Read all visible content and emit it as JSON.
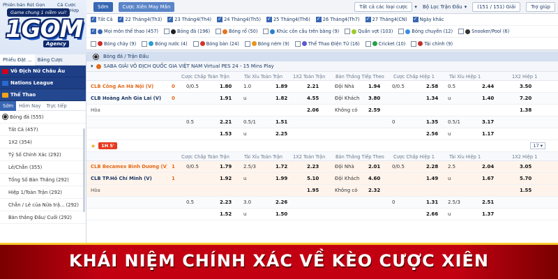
{
  "logo": {
    "top_left": "Phiên bản Rút Gọn",
    "top_right": "Cá Cược Tổng Hợp",
    "ribbon": "Game chung 1 niềm vui!",
    "brand": "1GOM",
    "agency": "Agency"
  },
  "topbar": {
    "tab_som": "Sớm",
    "tab_xien": "Cược Xiên May Mắn",
    "select_all_types": "Tất cả các loại cược",
    "filter_matches": "Bộ Lọc Trận Đấu",
    "pager": "(151 / 151)",
    "pager_suffix": "Giải",
    "help": "Trợ giúp"
  },
  "date_filters": [
    {
      "label": "Tất Cả",
      "checked": true
    },
    {
      "label": "22 Tháng4(Th3)",
      "checked": true
    },
    {
      "label": "23 Tháng4(Th4)",
      "checked": true
    },
    {
      "label": "24 Tháng4(Th5)",
      "checked": true
    },
    {
      "label": "25 Tháng4(Th6)",
      "checked": true
    },
    {
      "label": "26 Tháng4(Th7)",
      "checked": true
    },
    {
      "label": "27 Tháng4(CN)",
      "checked": true
    },
    {
      "label": "Ngày khác",
      "checked": true
    }
  ],
  "sport_filters_row1": [
    {
      "label": "Mọi môn thể thao (457)",
      "checked": true,
      "color": "#3867b3"
    },
    {
      "label": "Bóng đá (196)",
      "checked": false,
      "color": "#222222"
    },
    {
      "label": "Bóng rổ (50)",
      "checked": false,
      "color": "#e8741c"
    },
    {
      "label": "Khúc côn cầu trên băng (9)",
      "checked": false,
      "color": "#2a7fd0"
    },
    {
      "label": "Quần vợt (103)",
      "checked": false,
      "color": "#9ccc2a"
    },
    {
      "label": "Bóng chuyền (12)",
      "checked": false,
      "color": "#3c8fe0"
    },
    {
      "label": "Snooker/Pool (6)",
      "checked": false,
      "color": "#333333"
    }
  ],
  "sport_filters_row2": [
    {
      "label": "Bóng chày (9)",
      "checked": false,
      "color": "#cc2a2a"
    },
    {
      "label": "Bóng nước (4)",
      "checked": false,
      "color": "#2a9fd0"
    },
    {
      "label": "Bóng bàn (24)",
      "checked": false,
      "color": "#d0342a"
    },
    {
      "label": "Bóng ném (9)",
      "checked": false,
      "color": "#e8941c"
    },
    {
      "label": "Thể Thao Điện Tử (16)",
      "checked": false,
      "color": "#5a5ad0"
    },
    {
      "label": "Cricket (10)",
      "checked": false,
      "color": "#2aa048"
    },
    {
      "label": "Tài chính (9)",
      "checked": false,
      "color": "#c0302a"
    }
  ],
  "sidebar": {
    "tab_phieu": "Phiếu Đặt ...",
    "tab_bang": "Bảng Cược",
    "sections": [
      "Vô Địch Nữ Châu Âu",
      "Nations League",
      "Thể Thao"
    ],
    "subtabs": [
      "Sớm",
      "Hôm Nay",
      "Trực tiếp"
    ],
    "items": [
      "Bóng đá (555)",
      "Tất Cả (457)",
      "1X2 (354)",
      "Tỷ Số Chính Xác (292)",
      "Lẻ/Chẵn (355)",
      "Tổng Số Bàn Thắng (292)",
      "Hiệp 1/Toàn Trận (292)",
      "Chẵn / Lẻ của Nửa trậ... (292)",
      "Bàn thắng Đầu/ Cuối (292)"
    ]
  },
  "main": {
    "section_title": "Bóng đá / Trận Đấu",
    "league": "SABA GIẢI VÔ ĐỊCH QUỐC GIA VIỆT NAM Virtual PES 24 - 15 Mins Play",
    "headers": [
      "Cược Chấp Toàn Trận",
      "Tài Xỉu Toàn Trận",
      "1X2 Toàn Trận",
      "Bàn Thắng Tiếp Theo",
      "Cược Chấp Hiệp 1",
      "Tài Xỉu Hiệp 1",
      "1X2 Hiệp 1"
    ],
    "match1": {
      "home": "CLB Công An Hà Nội (V)",
      "away": "CLB Hoàng Anh Gia Lai (V)",
      "draw": "Hòa",
      "home_score": "0",
      "away_score": "0",
      "rows": [
        [
          "0/0.5",
          "1.80",
          "1.0",
          "1.89",
          "2.21",
          "Đội Nhà",
          "1.94",
          "0/0.5",
          "2.58",
          "0.5",
          "2.44",
          "3.50"
        ],
        [
          "",
          "1.91",
          "u",
          "1.82",
          "4.55",
          "Đội Khách",
          "3.80",
          "",
          "1.34",
          "u",
          "1.40",
          "7.20"
        ],
        [
          "",
          "",
          "",
          "",
          "2.06",
          "Không có",
          "2.59",
          "",
          "",
          "",
          "",
          "1.38"
        ],
        [
          "0.5",
          "2.21",
          "0.5/1",
          "1.51",
          "",
          "",
          "",
          "0",
          "1.35",
          "0.5/1",
          "3.17",
          ""
        ],
        [
          "",
          "1.53",
          "u",
          "2.25",
          "",
          "",
          "",
          "",
          "2.56",
          "u",
          "1.17",
          ""
        ]
      ]
    },
    "live_badge": "1H 5'",
    "more_count": "17",
    "match2": {
      "home": "CLB Becamex Bình Dương (V)",
      "away": "CLB TP.Hồ Chí Minh (V)",
      "draw": "Hòa",
      "home_score": "1",
      "away_score": "1",
      "rows": [
        [
          "0/0.5",
          "1.79",
          "2.5/3",
          "1.72",
          "2.23",
          "Đội Nhà",
          "2.01",
          "0/0.5",
          "2.28",
          "2.5",
          "2.04",
          "3.05"
        ],
        [
          "",
          "1.92",
          "u",
          "1.99",
          "5.10",
          "Đội Khách",
          "4.60",
          "",
          "1.49",
          "u",
          "1.67",
          "5.70"
        ],
        [
          "",
          "",
          "",
          "",
          "1.95",
          "Không có",
          "2.32",
          "",
          "",
          "",
          "",
          "1.55"
        ],
        [
          "0.5",
          "2.23",
          "3.0",
          "2.26",
          "",
          "",
          "",
          "0",
          "1.31",
          "2.5/3",
          "2.51",
          ""
        ],
        [
          "",
          "1.52",
          "u",
          "1.50",
          "",
          "",
          "",
          "",
          "2.66",
          "u",
          "1.37",
          ""
        ]
      ]
    }
  },
  "banner": {
    "text": "KHÁI NIỆM CHÍNH XÁC VỀ KÈO CƯỢC XIÊN"
  }
}
